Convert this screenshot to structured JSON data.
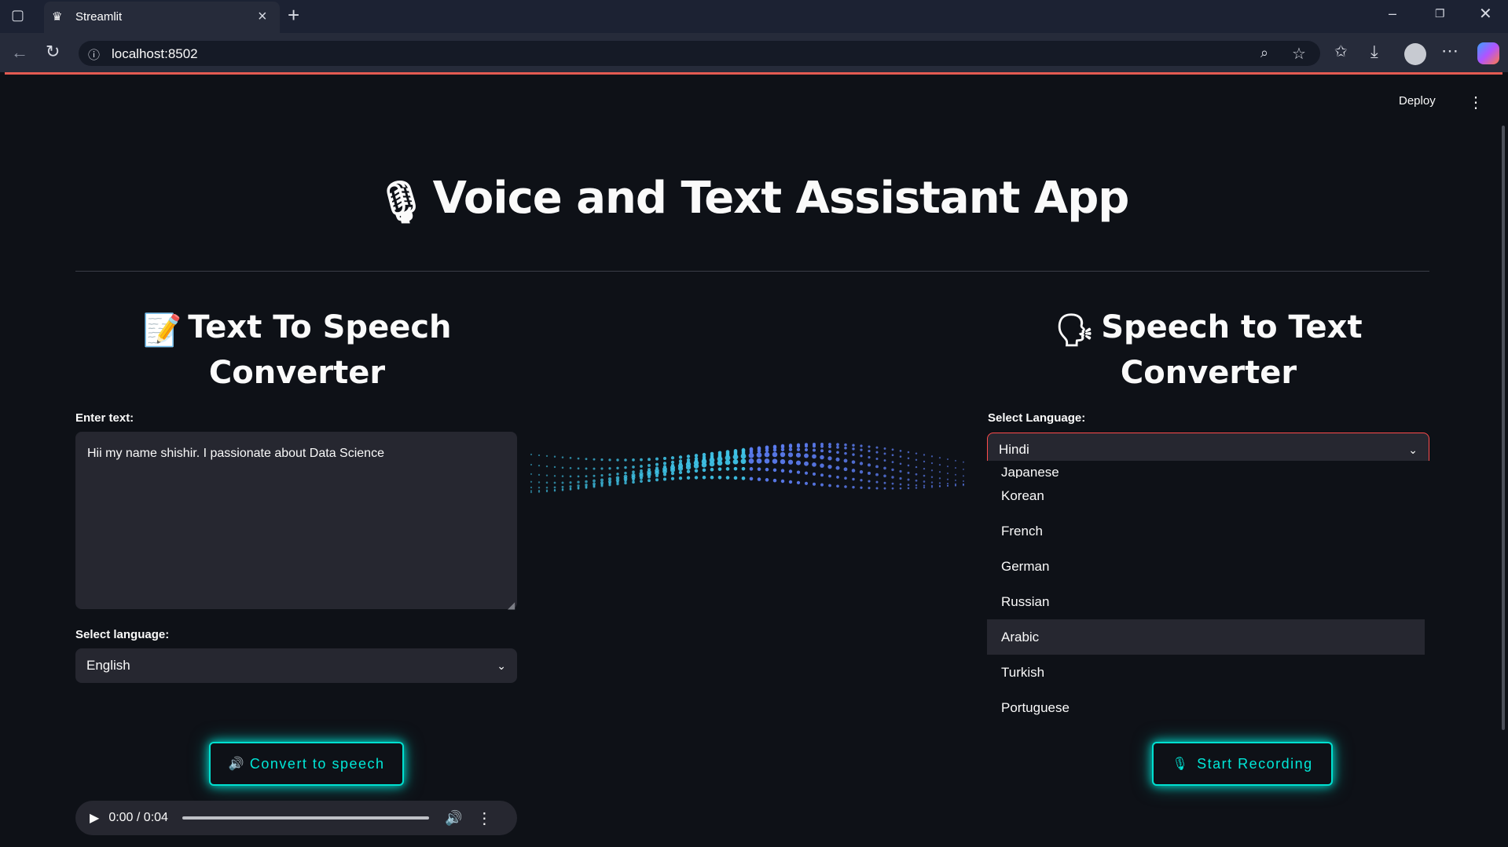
{
  "browser": {
    "tab_title": "Streamlit",
    "url": "localhost:8502"
  },
  "app": {
    "deploy_label": "Deploy",
    "title": "Voice and Text Assistant App",
    "title_icon": "microphone-icon",
    "tts": {
      "heading": "Text To Speech Converter",
      "heading_icon": "memo-icon",
      "text_label": "Enter text:",
      "text_value": "Hii my name shishir. I passionate about Data Science",
      "language_label": "Select language:",
      "language_value": "English",
      "button_label": "Convert to speech",
      "button_icon": "speaker-icon"
    },
    "stt": {
      "heading": "Speech to Text Converter",
      "heading_icon": "speaking-head-icon",
      "language_label": "Select Language:",
      "language_value": "Hindi",
      "options": [
        "Japanese",
        "Korean",
        "French",
        "German",
        "Russian",
        "Arabic",
        "Turkish",
        "Portuguese"
      ],
      "highlighted_option": "Arabic",
      "button_label": "Start Recording",
      "button_icon": "microphone-icon"
    },
    "audio": {
      "time": "0:00 / 0:04",
      "progress": 0
    }
  },
  "colors": {
    "background": "#0e1117",
    "widget": "#262730",
    "accent_red": "#ff4b4b",
    "glow": "#00e0d0"
  }
}
